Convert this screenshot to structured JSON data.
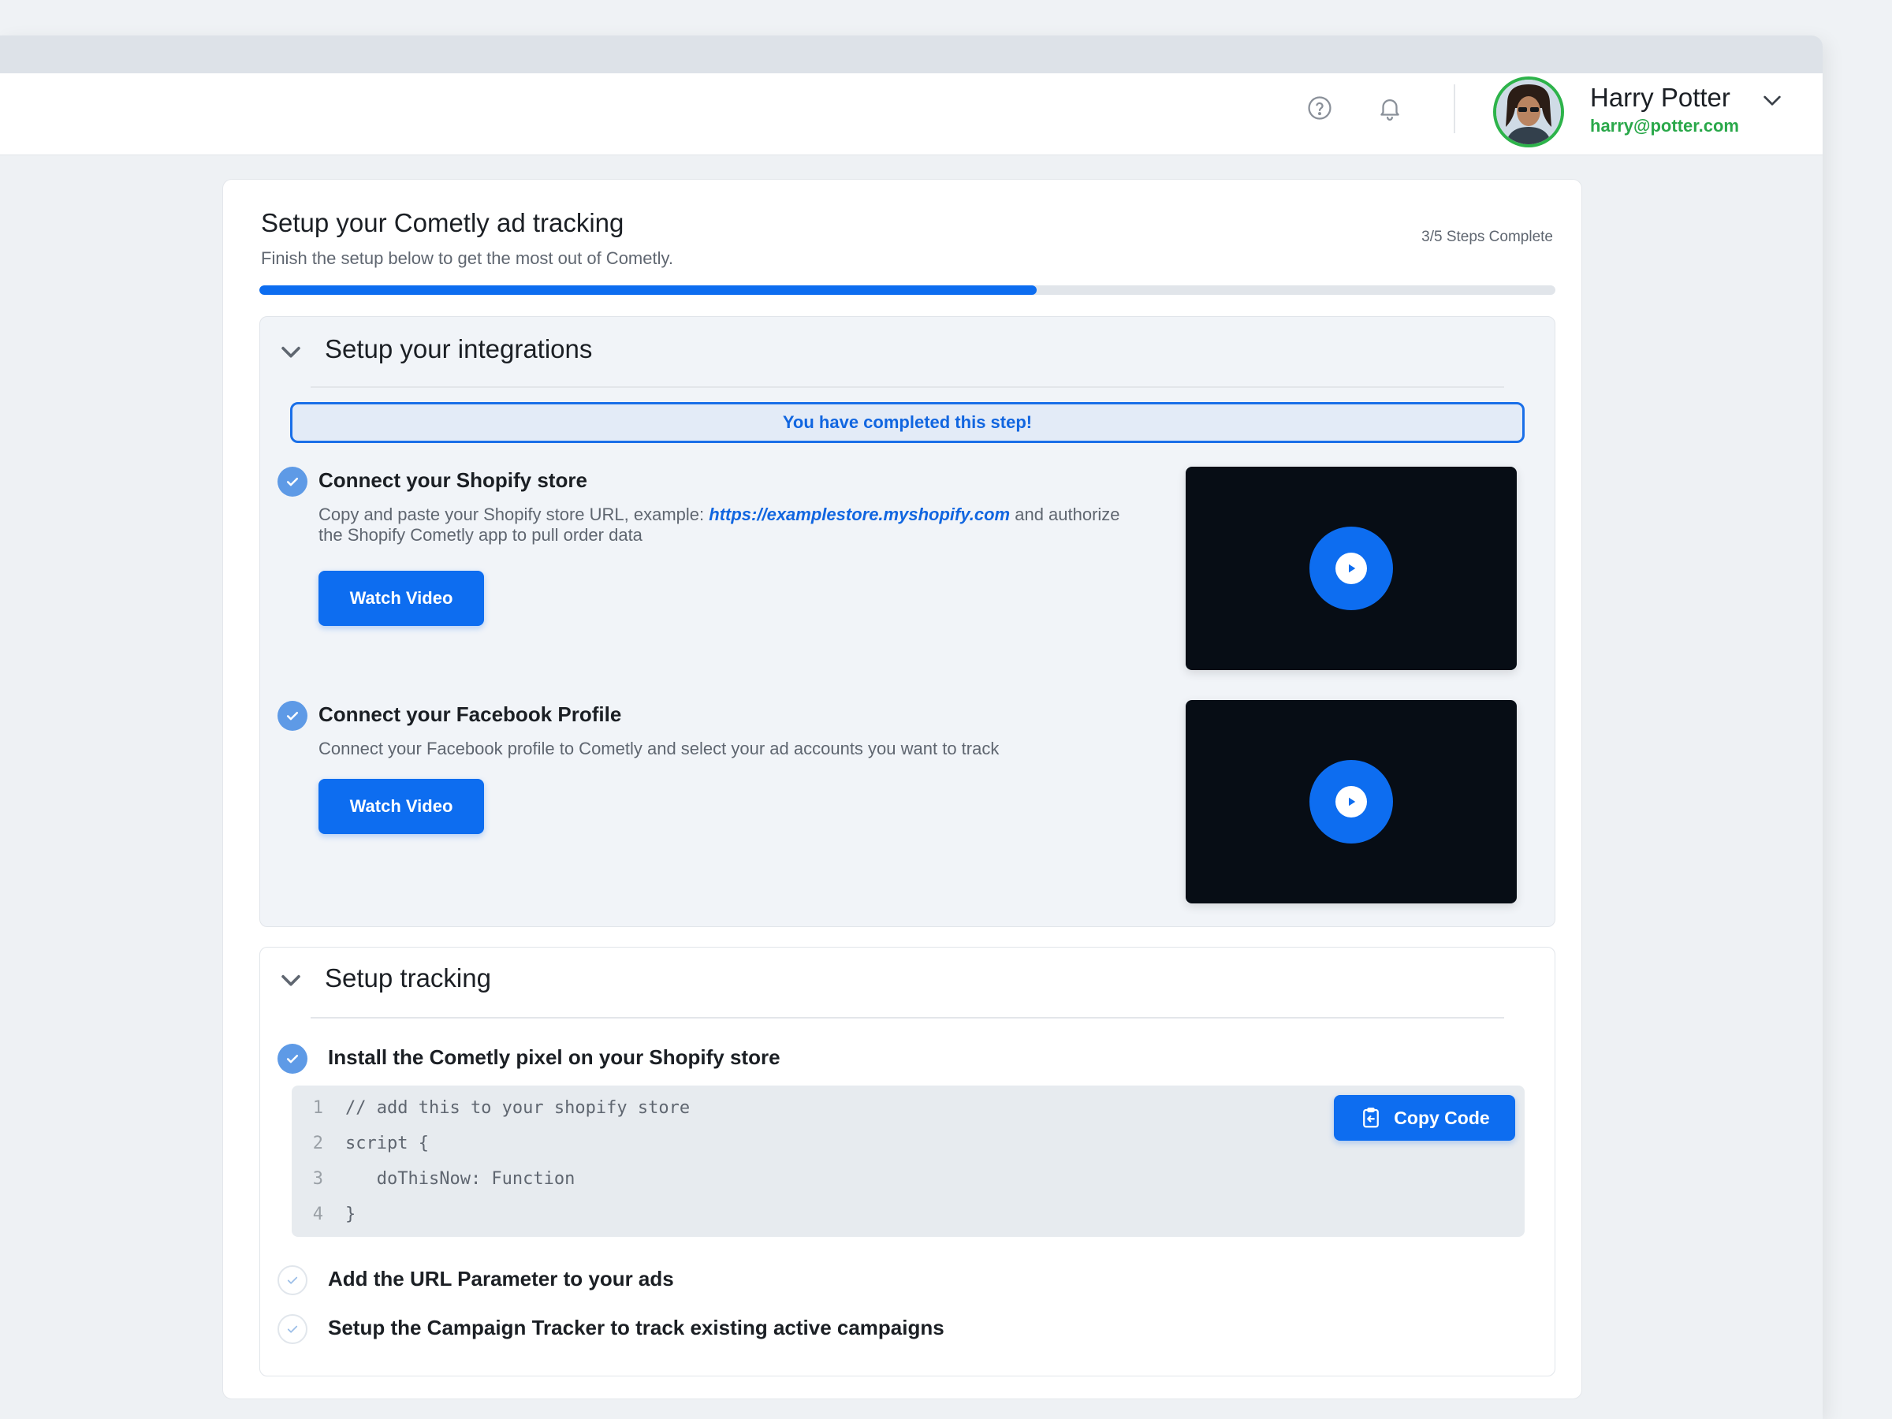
{
  "header": {
    "user_name": "Harry Potter",
    "user_email": "harry@potter.com",
    "help_icon": "help-circle-icon",
    "bell_icon": "bell-icon"
  },
  "setup": {
    "title": "Setup your Cometly ad tracking",
    "subtitle": "Finish the setup below to get the most out of Cometly.",
    "steps_complete": "3/5 Steps Complete",
    "progress_fraction": 0.6
  },
  "integrations": {
    "title": "Setup your integrations",
    "banner": "You have completed this step!",
    "tasks": [
      {
        "title": "Connect your Shopify store",
        "desc_before": "Copy and paste your Shopify store URL, example: ",
        "desc_link": "https://examplestore.myshopify.com",
        "desc_after": " and authorize the Shopify Cometly app to pull order data",
        "button": "Watch Video"
      },
      {
        "title": "Connect your Facebook Profile",
        "desc": "Connect your Facebook profile to Cometly and select your ad accounts you want to track",
        "button": "Watch Video"
      }
    ]
  },
  "tracking": {
    "title": "Setup tracking",
    "pixel_task": "Install the Cometly pixel on your Shopify store",
    "copy_button": "Copy Code",
    "code_lines": [
      {
        "num": "1",
        "text": "// add this to your shopify store"
      },
      {
        "num": "2",
        "text": "script {"
      },
      {
        "num": "3",
        "text": "   doThisNow: Function"
      },
      {
        "num": "4",
        "text": "}"
      }
    ],
    "tasks": [
      "Add the URL Parameter to your ads",
      "Setup the Campaign Tracker to track existing active campaigns"
    ]
  },
  "colors": {
    "accent": "#0d6df0",
    "success": "#2aa84a",
    "check": "#5e9ae6"
  }
}
